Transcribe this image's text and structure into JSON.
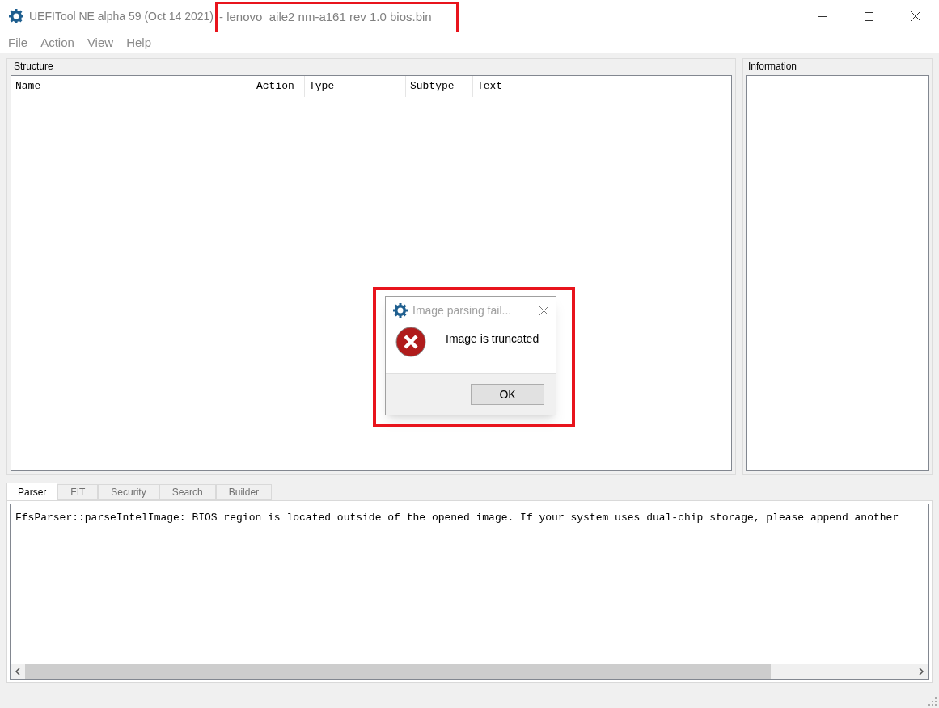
{
  "window": {
    "title": "UEFITool NE alpha 59 (Oct 14 2021)",
    "file": "- lenovo_aile2 nm-a161 rev 1.0 bios.bin"
  },
  "menu": [
    "File",
    "Action",
    "View",
    "Help"
  ],
  "structure": {
    "title": "Structure",
    "columns": [
      "Name",
      "Action",
      "Type",
      "Subtype",
      "Text"
    ]
  },
  "information": {
    "title": "Information"
  },
  "tabs": [
    {
      "label": "Parser",
      "selected": true
    },
    {
      "label": "FIT",
      "selected": false
    },
    {
      "label": "Security",
      "selected": false
    },
    {
      "label": "Search",
      "selected": false
    },
    {
      "label": "Builder",
      "selected": false
    }
  ],
  "log": [
    "FfsParser::parseIntelImage: BIOS region is located outside of the opened image. If your system uses dual-chip storage, please append another"
  ],
  "dialog": {
    "title": "Image parsing fail...",
    "message": "Image is truncated",
    "buttons": [
      "OK"
    ]
  }
}
